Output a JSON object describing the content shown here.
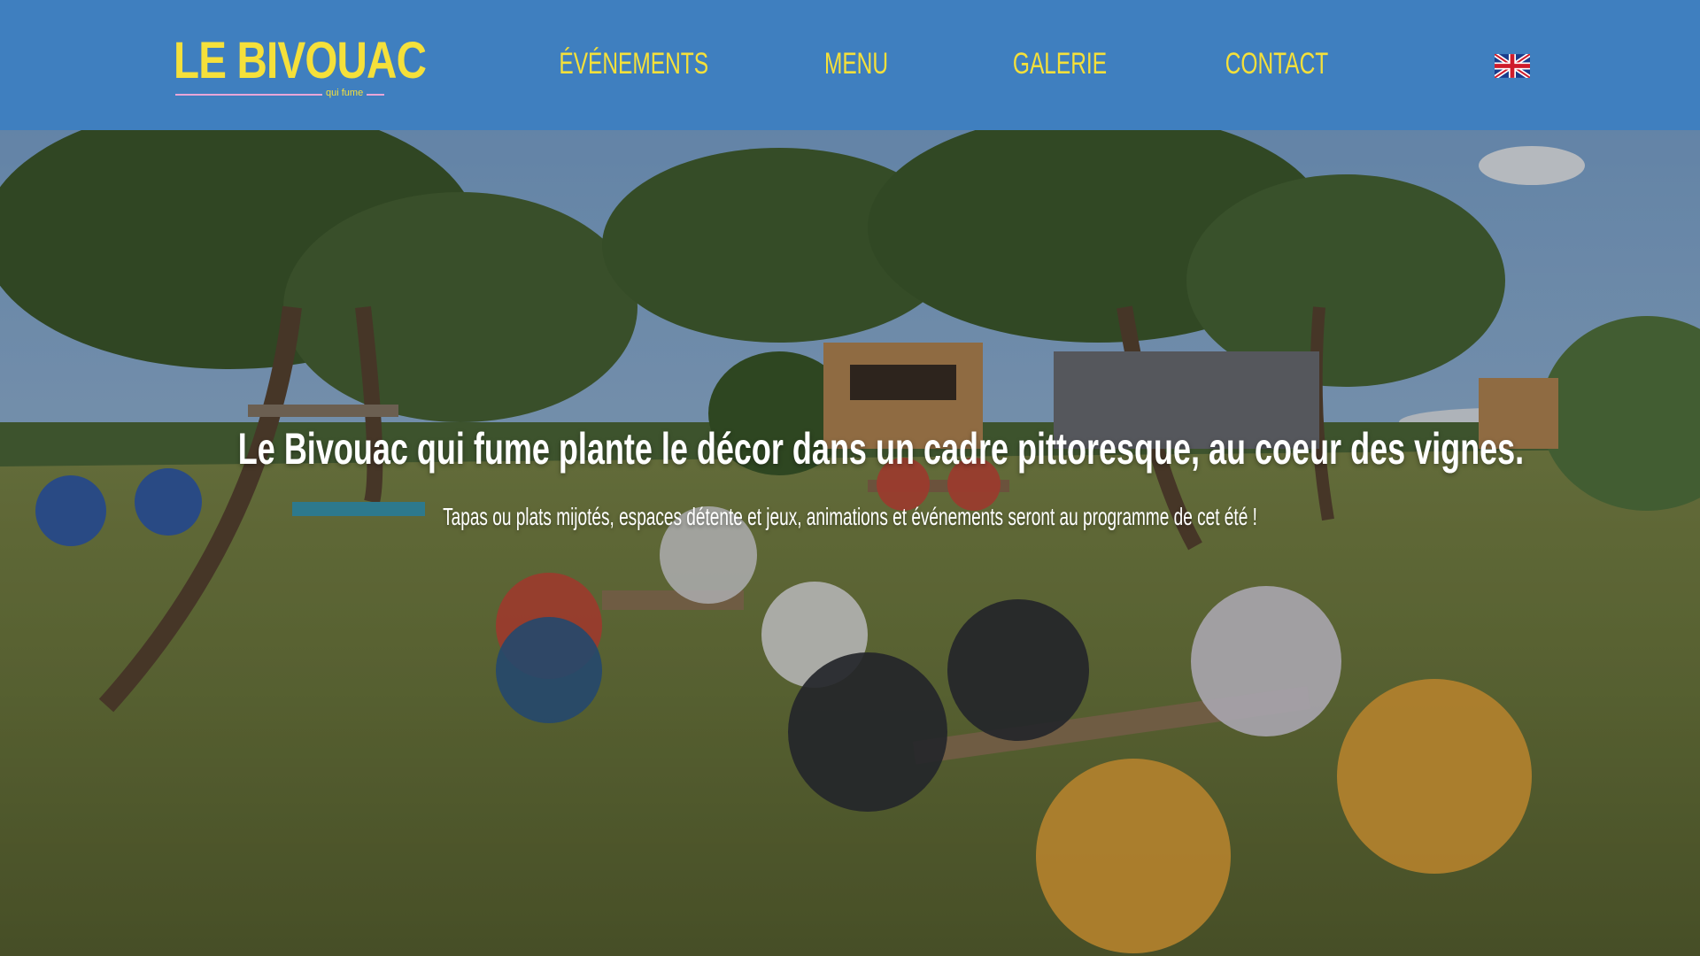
{
  "header": {
    "logo": {
      "main_text": "LE BIVOUAC",
      "sub_text": "qui fume"
    },
    "nav": [
      {
        "label": "ÉVÉNEMENTS"
      },
      {
        "label": "MENU"
      },
      {
        "label": "GALERIE"
      },
      {
        "label": "CONTACT"
      }
    ],
    "language_icon": "uk-flag-icon"
  },
  "hero": {
    "title": "Le Bivouac qui fume plante le décor dans un cadre pittoresque, au coeur des vignes.",
    "subtitle": "Tapas ou plats mijotés, espaces détente et jeux, animations et événements seront au programme de cet été !"
  },
  "colors": {
    "header_bg": "#3f7fbf",
    "accent_yellow": "#f5e03a",
    "logo_line_pink": "#e9a6d8"
  }
}
